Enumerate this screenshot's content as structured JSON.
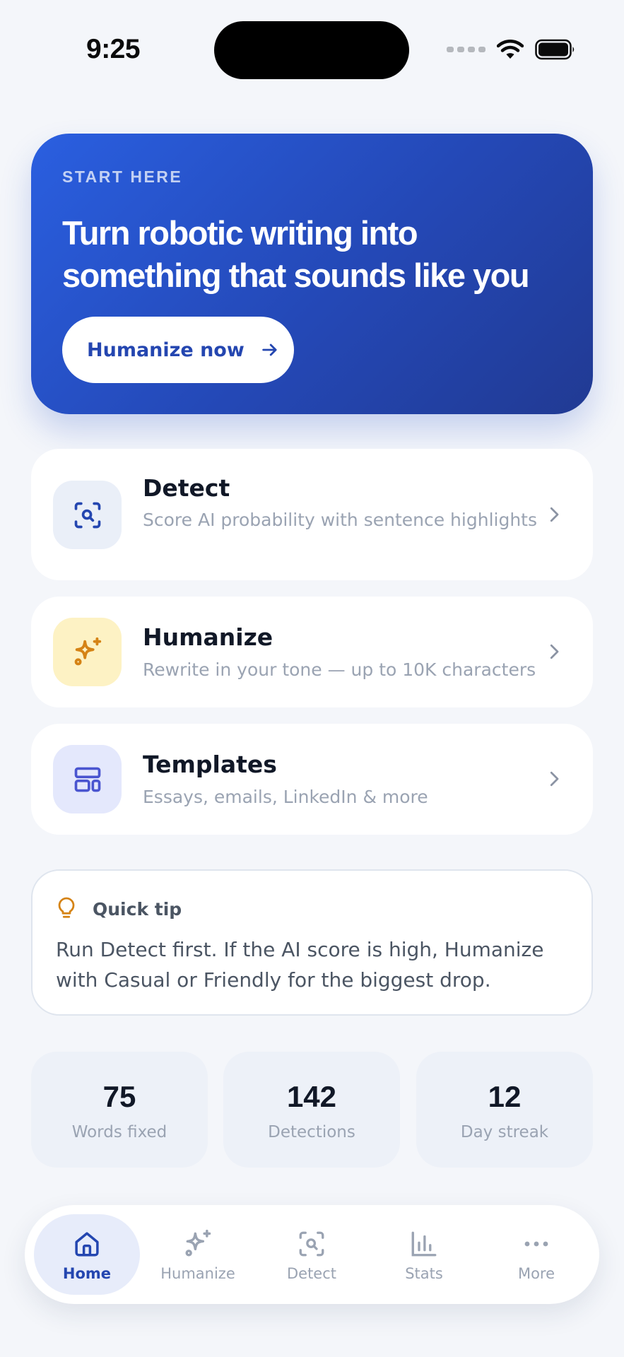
{
  "status_bar": {
    "time": "9:25"
  },
  "hero": {
    "eyebrow": "START HERE",
    "title_line1": "Turn robotic writing into",
    "title_line2": "something that sounds like you",
    "cta_label": "Humanize now"
  },
  "features": [
    {
      "title": "Detect",
      "subtitle": "Score AI probability with sentence highlights",
      "icon": "scan-search-icon",
      "tile_color": "#eaeff8",
      "icon_color": "#2446b0"
    },
    {
      "title": "Humanize",
      "subtitle": "Rewrite in your tone — up to 10K characters",
      "icon": "sparkle-icon",
      "tile_color": "#fdf2c4",
      "icon_color": "#d58315"
    },
    {
      "title": "Templates",
      "subtitle": "Essays, emails, LinkedIn & more",
      "icon": "layout-icon",
      "tile_color": "#e4e8fc",
      "icon_color": "#4a55d0"
    }
  ],
  "tip": {
    "title": "Quick tip",
    "body": "Run Detect first. If the AI score is high, Humanize with Casual or Friendly for the biggest drop."
  },
  "stats": [
    {
      "value": "75",
      "label": "Words fixed"
    },
    {
      "value": "142",
      "label": "Detections"
    },
    {
      "value": "12",
      "label": "Day streak"
    }
  ],
  "tabs": [
    {
      "label": "Home",
      "icon": "home-icon",
      "active": true
    },
    {
      "label": "Humanize",
      "icon": "sparkle-icon",
      "active": false
    },
    {
      "label": "Detect",
      "icon": "scan-search-icon",
      "active": false
    },
    {
      "label": "Stats",
      "icon": "bar-chart-icon",
      "active": false
    },
    {
      "label": "More",
      "icon": "more-icon",
      "active": false
    }
  ],
  "colors": {
    "accent": "#2446b0",
    "hero_start": "#2a5fe0",
    "hero_end": "#213a93",
    "background": "#f4f6fa",
    "tip_icon": "#d58315"
  }
}
